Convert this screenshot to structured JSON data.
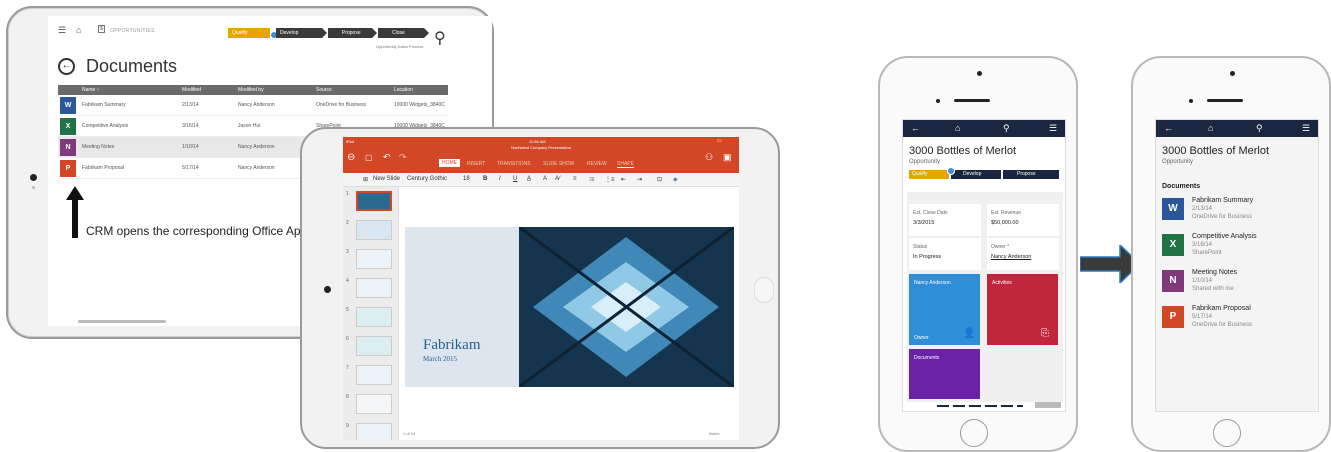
{
  "colors": {
    "word": "#2b579a",
    "excel": "#217346",
    "onenote": "#80397b",
    "powerpoint": "#d24726",
    "crm_nav": "#1b2640",
    "stage_active": "#e6a500",
    "stage_idle": "#3a3a3a"
  },
  "crm_tablet": {
    "breadcrumb": "OPPORTUNITIES",
    "stages": [
      "Qualify",
      "Develop",
      "Propose",
      "Close"
    ],
    "process_label": "Opportunity Sales Process",
    "title": "Documents",
    "columns": [
      "Name ↑",
      "Modified",
      "Modified by",
      "Source",
      "Location"
    ],
    "rows": [
      {
        "icon": "W",
        "name": "Fabrikam Summary",
        "modified": "2/13/14",
        "by": "Nancy Anderson",
        "source": "OneDrive for Business",
        "location": "10000 Widgets_3840C"
      },
      {
        "icon": "X",
        "name": "Competitive Analysis",
        "modified": "3/16/14",
        "by": "Jason Hui",
        "source": "SharePoint",
        "location": "10000 Widgets_3840C"
      },
      {
        "icon": "N",
        "name": "Meeting Notes",
        "modified": "1/10/14",
        "by": "Nancy Anderson",
        "source": "",
        "location": ""
      },
      {
        "icon": "P",
        "name": "Fabrikam Proposal",
        "modified": "5/17/14",
        "by": "Nancy Anderson",
        "source": "",
        "location": ""
      }
    ],
    "caption": "CRM opens the corresponding Office App"
  },
  "ppt_tablet": {
    "status_left": "iPad",
    "status_time": "11:56 AM",
    "doc_title": "Northwind Company Presentation",
    "tabs": [
      "HOME",
      "INSERT",
      "TRANSITIONS",
      "SLIDE SHOW",
      "REVIEW",
      "SHAPE"
    ],
    "new_slide": "New Slide",
    "font_name": "Century Gothic",
    "font_size": "18",
    "thumb_numbers": [
      "1",
      "2",
      "3",
      "4",
      "5",
      "6",
      "7",
      "8",
      "9"
    ],
    "slide_title": "Fabrikam",
    "slide_date": "March 2015",
    "page_indicator": "1 of 13",
    "notes_label": "Notes"
  },
  "phone1": {
    "title": "3000 Bottles of Merlot",
    "subtitle": "Opportunity",
    "stages": [
      "Qualify",
      "Develop",
      "Propose"
    ],
    "fields": [
      {
        "label": "Est. Close Date",
        "value": "3/3/2015"
      },
      {
        "label": "Est. Revenue",
        "value": "$50,000.00"
      },
      {
        "label": "Status",
        "value": "In Progress"
      },
      {
        "label": "Owner *",
        "value": "Nancy Anderson"
      }
    ],
    "tiles": {
      "owner_name": "Nancy Anderson",
      "owner_label": "Owner",
      "activities": "Activities",
      "documents": "Documents"
    }
  },
  "phone2": {
    "title": "3000 Bottles of Merlot",
    "subtitle": "Opportunity",
    "section": "Documents",
    "docs": [
      {
        "icon": "W",
        "name": "Fabrikam Summary",
        "date": "2/13/14",
        "source": "OneDrive for Business"
      },
      {
        "icon": "X",
        "name": "Competitive Analysis",
        "date": "3/16/14",
        "source": "SharePoint"
      },
      {
        "icon": "N",
        "name": "Meeting Notes",
        "date": "1/10/14",
        "source": "Shared with me"
      },
      {
        "icon": "P",
        "name": "Fabrikam Proposal",
        "date": "5/17/14",
        "source": "OneDrive for Business"
      }
    ]
  }
}
